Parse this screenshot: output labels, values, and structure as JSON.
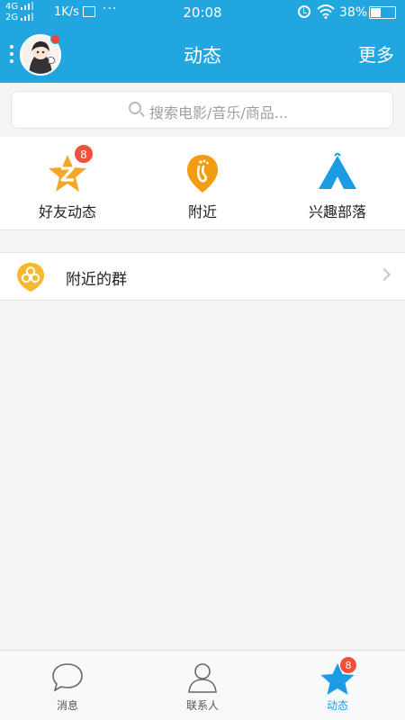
{
  "status_bar": {
    "network_1": "4G",
    "network_2": "2G",
    "speed": "1K/s",
    "dots": "···",
    "time": "20:08",
    "battery_percent": "38%",
    "battery_level": 0.38
  },
  "header": {
    "title": "动态",
    "more": "更多"
  },
  "search": {
    "placeholder": "搜索电影/音乐/商品..."
  },
  "shortcuts": [
    {
      "label": "好友动态",
      "badge": "8",
      "icon": "friends-feed-star-icon",
      "color": "#f5a623"
    },
    {
      "label": "附近",
      "icon": "nearby-footprint-icon",
      "color": "#f39c12"
    },
    {
      "label": "兴趣部落",
      "icon": "tribe-tent-icon",
      "color": "#1a9be2"
    }
  ],
  "list": [
    {
      "label": "附近的群",
      "icon": "nearby-groups-icon",
      "color": "#f5b82e"
    }
  ],
  "tabs": [
    {
      "label": "消息",
      "icon": "message-bubble-icon"
    },
    {
      "label": "联系人",
      "icon": "contacts-person-icon"
    },
    {
      "label": "动态",
      "badge": "8",
      "icon": "star-icon",
      "active": true
    }
  ],
  "colors": {
    "header_blue": "#21a6df",
    "badge_red": "#f0503c",
    "active_tab_blue": "#1e9be6"
  }
}
